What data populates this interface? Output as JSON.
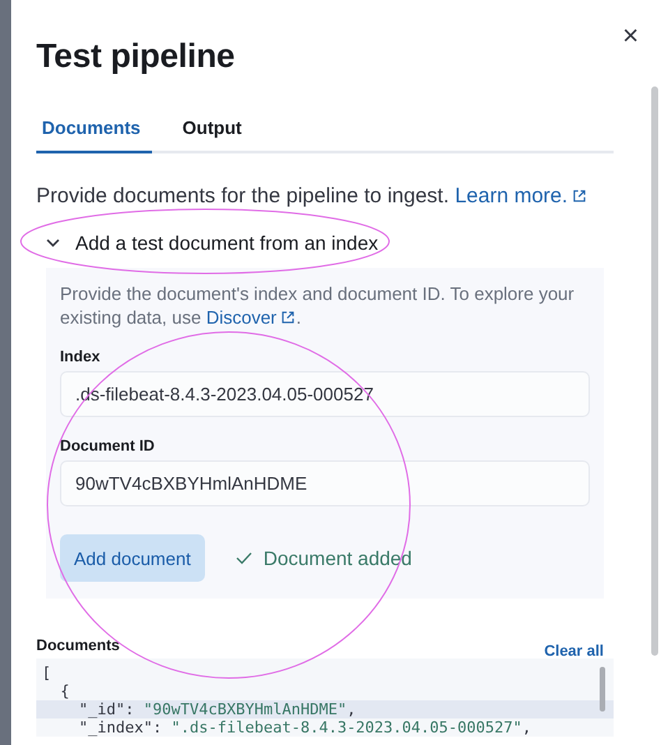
{
  "flyout": {
    "title": "Test pipeline",
    "close": "×"
  },
  "tabs": [
    {
      "label": "Documents",
      "selected": true
    },
    {
      "label": "Output",
      "selected": false
    }
  ],
  "intro": {
    "text": "Provide documents for the pipeline to ingest.",
    "link": "Learn more."
  },
  "accordion": {
    "label": "Add a test document from an index",
    "expanded": true,
    "help": {
      "text": "Provide the document's index and document ID. To explore your existing data, use",
      "link": "Discover",
      "after": "."
    },
    "fields": [
      {
        "label": "Index",
        "value": ".ds-filebeat-8.4.3-2023.04.05-000527"
      },
      {
        "label": "Document ID",
        "value": "90wTV4cBXBYHmlAnHDME"
      }
    ],
    "button": "Add document",
    "status": "Document added"
  },
  "documents": {
    "label": "Documents",
    "clear": "Clear all",
    "lines": [
      {
        "text": "[",
        "highlighted": false,
        "children": [
          {
            "text": "{",
            "highlighted": false,
            "children": [
              {
                "key": "\"_id\":",
                "value": "\"90wTV4cBXBYHmlAnHDME\"",
                "punct": ",",
                "highlighted": true
              },
              {
                "key": "\"_index\":",
                "value": "\".ds-filebeat-8.4.3-2023.04.05-000527\"",
                "punct": ",",
                "highlighted": false
              }
            ]
          }
        ]
      }
    ]
  }
}
